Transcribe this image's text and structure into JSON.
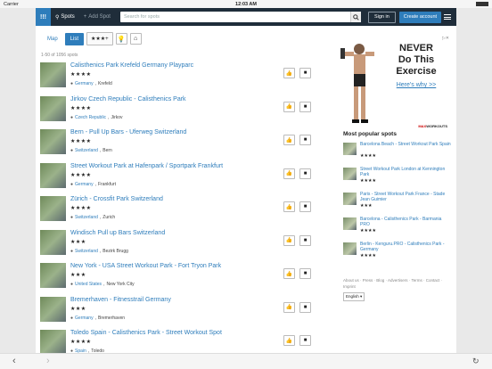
{
  "status_bar": {
    "carrier": "Carrier",
    "time": "12:03 AM"
  },
  "nav": {
    "logo": "!!!",
    "spots_label": "Spots",
    "add_spot_label": "Add Spot",
    "search_placeholder": "Search for spots",
    "sign_in": "Sign in",
    "create_account": "Create account"
  },
  "toolbar": {
    "map": "Map",
    "list": "List",
    "rating_filter": "★★★+"
  },
  "results_count": "1-50 of 1056 spots",
  "spots": [
    {
      "title": "Calisthenics Park Krefeld Germany Playparc",
      "stars": "★★★★",
      "country": "Germany",
      "city": "Krefeld"
    },
    {
      "title": "Jirkov Czech Republic - Calisthenics Park",
      "stars": "★★★★",
      "country": "Czech Republic",
      "city": "Jirkov"
    },
    {
      "title": "Bern - Pull Up Bars - Uferweg Switzerland",
      "stars": "★★★★",
      "country": "Switzerland",
      "city": "Bern"
    },
    {
      "title": "Street Workout Park at Hafenpark / Sportpark Frankfurt",
      "stars": "★★★★",
      "country": "Germany",
      "city": "Frankfurt"
    },
    {
      "title": "Zürich - Crossfit Park Switzerland",
      "stars": "★★★★",
      "country": "Switzerland",
      "city": "Zurich"
    },
    {
      "title": "Windisch Pull up Bars Switzerland",
      "stars": "★★★",
      "country": "Switzerland",
      "city": "Bezirk Brugg"
    },
    {
      "title": "New York - USA Street Workout Park - Fort Tryon Park",
      "stars": "★★★",
      "country": "United States",
      "city": "New York City"
    },
    {
      "title": "Bremerhaven - Fitnesstrail Germany",
      "stars": "★★★",
      "country": "Germany",
      "city": "Bremerhaven"
    },
    {
      "title": "Toledo Spain - Calisthenics Park - Street Workout Spot",
      "stars": "★★★★",
      "country": "Spain",
      "city": "Toledo"
    }
  ],
  "ad": {
    "headline_1": "NEVER",
    "headline_2": "Do This",
    "headline_3": "Exercise",
    "link": "Here's why >>",
    "brand_a": "MAX",
    "brand_b": "WORKOUTS"
  },
  "popular": {
    "title": "Most popular spots",
    "items": [
      {
        "name": "Barcelona Beach - Street Workout Park Spain",
        "stars": "★★★★"
      },
      {
        "name": "Street Workout Park London at Kennington Park",
        "stars": "★★★★"
      },
      {
        "name": "Paris - Street Workout Park France - Stade Jean Guimier",
        "stars": "★★★"
      },
      {
        "name": "Barcelona - Calisthenics Park - Barmania PRO",
        "stars": "★★★★"
      },
      {
        "name": "Berlin - Kenguru.PRO - Calisthenics Park - Germany",
        "stars": "★★★★"
      }
    ]
  },
  "footer": {
    "links": "About us · Press · Blog · Advertisers · Terms · Contact · Imprint",
    "language": "English"
  }
}
